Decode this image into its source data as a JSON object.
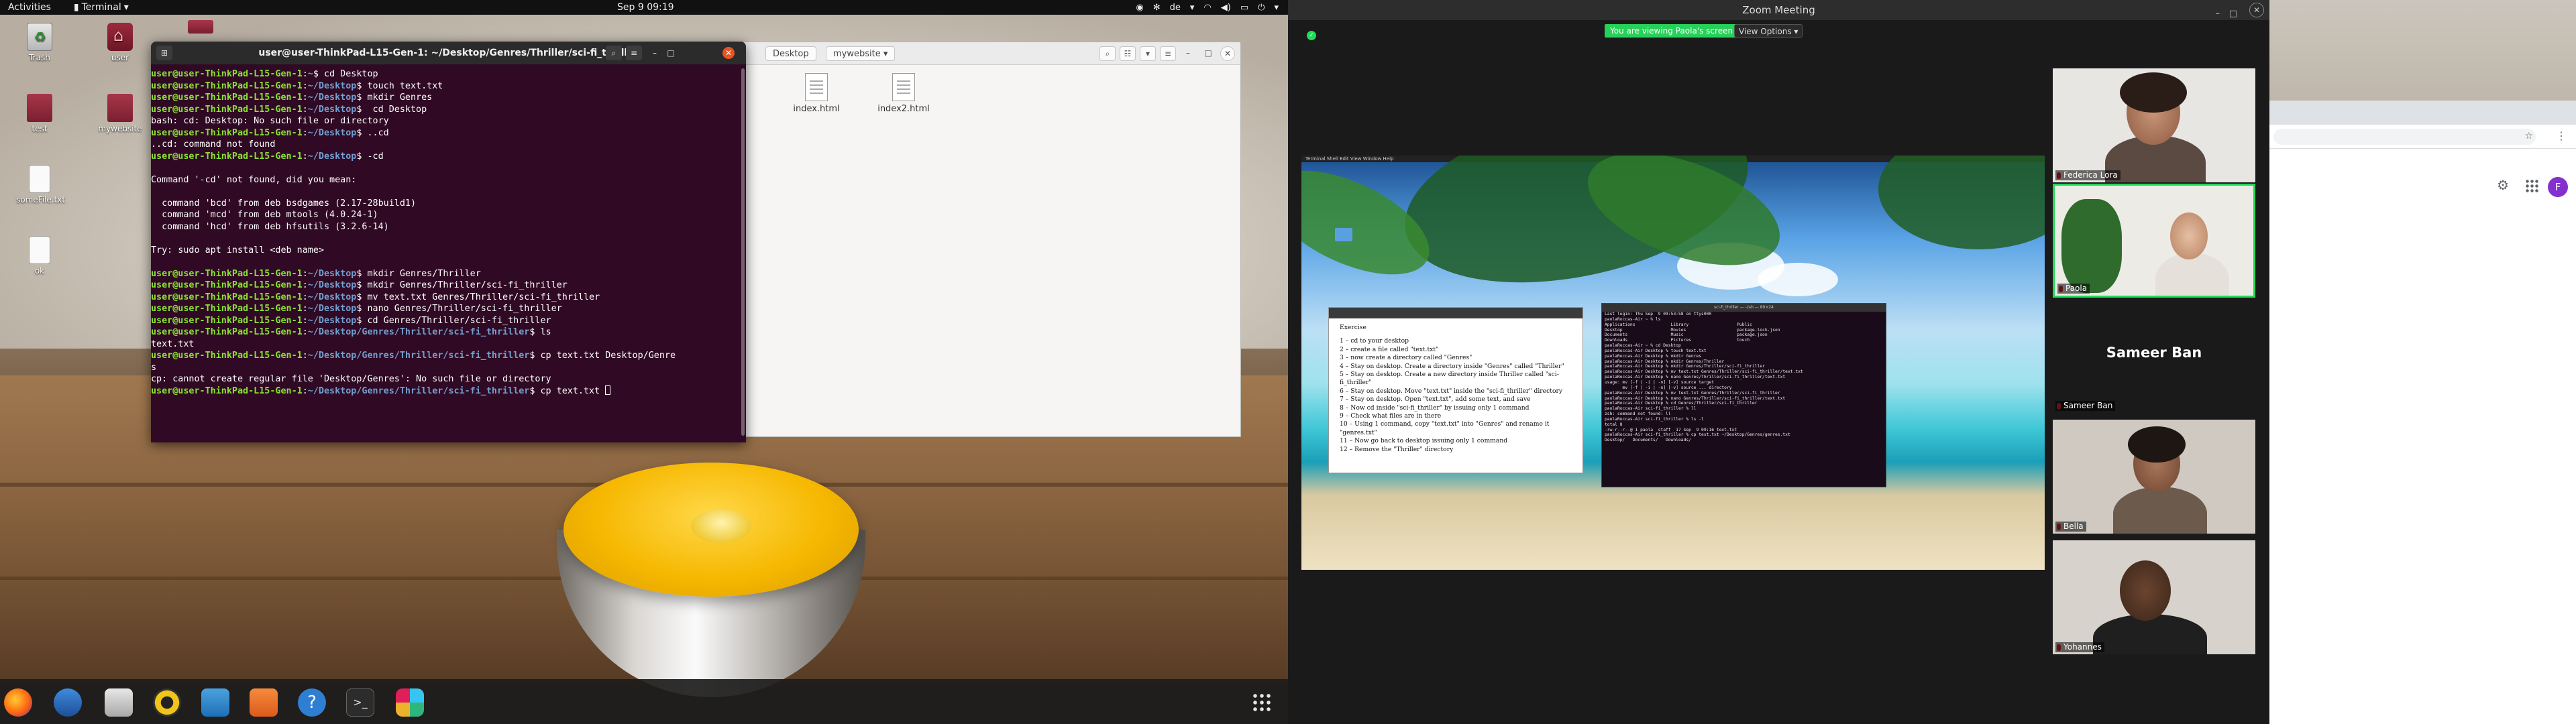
{
  "left_screen": {
    "topbar": {
      "activities": "Activities",
      "app_name": "Terminal",
      "clock": "Sep 9  09:19",
      "keyboard_layout": "de"
    },
    "desktop_icons": [
      {
        "label": "Trash",
        "icon": "trash-icon"
      },
      {
        "label": "user",
        "icon": "home-folder-icon"
      },
      {
        "label": "test",
        "icon": "folder-icon"
      },
      {
        "label": "mywebsite",
        "icon": "folder-icon"
      },
      {
        "label": "someFile.txt",
        "icon": "text-file-icon"
      },
      {
        "label": "ok",
        "icon": "text-file-icon"
      }
    ],
    "file_manager": {
      "breadcrumb": [
        "Desktop",
        "mywebsite"
      ],
      "files": [
        "index.html",
        "index2.html"
      ]
    },
    "terminal": {
      "title": "user@user-ThinkPad-L15-Gen-1: ~/Desktop/Genres/Thriller/sci-fi_thriller",
      "user_host": "user@user-ThinkPad-L15-Gen-1",
      "lines": [
        {
          "type": "prompt",
          "path": "~",
          "cmd": "$ cd Desktop"
        },
        {
          "type": "prompt",
          "path": "~/Desktop",
          "cmd": "$ touch text.txt"
        },
        {
          "type": "prompt",
          "path": "~/Desktop",
          "cmd": "$ mkdir Genres"
        },
        {
          "type": "prompt",
          "path": "~/Desktop",
          "cmd": "$  cd Desktop"
        },
        {
          "type": "out",
          "text": "bash: cd: Desktop: No such file or directory"
        },
        {
          "type": "prompt",
          "path": "~/Desktop",
          "cmd": "$ ..cd"
        },
        {
          "type": "out",
          "text": "..cd: command not found"
        },
        {
          "type": "prompt",
          "path": "~/Desktop",
          "cmd": "$ -cd"
        },
        {
          "type": "out",
          "text": ""
        },
        {
          "type": "out",
          "text": "Command '-cd' not found, did you mean:"
        },
        {
          "type": "out",
          "text": ""
        },
        {
          "type": "out",
          "text": "  command 'bcd' from deb bsdgames (2.17-28build1)"
        },
        {
          "type": "out",
          "text": "  command 'mcd' from deb mtools (4.0.24-1)"
        },
        {
          "type": "out",
          "text": "  command 'hcd' from deb hfsutils (3.2.6-14)"
        },
        {
          "type": "out",
          "text": ""
        },
        {
          "type": "out",
          "text": "Try: sudo apt install <deb name>"
        },
        {
          "type": "out",
          "text": ""
        },
        {
          "type": "prompt",
          "path": "~/Desktop",
          "cmd": "$ mkdir Genres/Thriller"
        },
        {
          "type": "prompt",
          "path": "~/Desktop",
          "cmd": "$ mkdir Genres/Thriller/sci-fi_thriller"
        },
        {
          "type": "prompt",
          "path": "~/Desktop",
          "cmd": "$ mv text.txt Genres/Thriller/sci-fi_thriller"
        },
        {
          "type": "prompt",
          "path": "~/Desktop",
          "cmd": "$ nano Genres/Thriller/sci-fi_thriller"
        },
        {
          "type": "prompt",
          "path": "~/Desktop",
          "cmd": "$ cd Genres/Thriller/sci-fi_thriller"
        },
        {
          "type": "prompt",
          "path": "~/Desktop/Genres/Thriller/sci-fi_thriller",
          "cmd": "$ ls"
        },
        {
          "type": "out",
          "text": "text.txt"
        },
        {
          "type": "prompt",
          "path": "~/Desktop/Genres/Thriller/sci-fi_thriller",
          "cmd": "$ cp text.txt Desktop/Genre"
        },
        {
          "type": "out",
          "text": "s"
        },
        {
          "type": "out",
          "text": "cp: cannot create regular file 'Desktop/Genres': No such file or directory"
        },
        {
          "type": "prompt",
          "path": "~/Desktop/Genres/Thriller/sci-fi_thriller",
          "cmd": "$ cp text.txt ",
          "cursor": true
        }
      ]
    },
    "dock_apps": [
      "firefox-icon",
      "thunderbird-icon",
      "files-icon",
      "rhythmbox-icon",
      "writer-icon",
      "software-icon",
      "help-icon",
      "terminal-icon",
      "slack-icon",
      "show-apps-icon"
    ]
  },
  "zoom": {
    "title": "Zoom Meeting",
    "viewing_banner": "You are viewing Paola's screen",
    "view_options": "View Options ▾",
    "shared_screen": {
      "exercise_title": "Exercise",
      "exercise_steps": [
        "1 – cd to your desktop",
        "2 – create a file called \"text.txt\"",
        "3 – now create a directory called \"Genres\"",
        "4 – Stay on desktop. Create a directory inside \"Genres\" called \"Thriller\"",
        "5 – Stay on desktop. Create a new directory inside Thriller called \"sci-fi_thriller\"",
        "6 – Stay on desktop. Move \"text.txt\" inside the \"sci-fi_thriller\" directory",
        "7 – Stay on desktop. Open \"text.txt\", add some text, and save",
        "8 – Now cd inside \"sci-fi_thriller\" by issuing only 1 command",
        "9 – Check what files are in there",
        "10 – Using 1 command, copy \"text.txt\" into \"Genres\" and rename it \"genres.txt\"",
        "11 – Now go back to desktop issuing only 1 command",
        "12 – Remove the \"Thriller\" directory"
      ],
      "mini_terminal_title": "sci-fi_thriller — -zsh — 80×24",
      "mini_terminal_lines": [
        "Last login: Thu Sep  9 09:53:58 on ttys000",
        "paolaRoccas-Air ~ % ls",
        "Applications              Library                   Public",
        "Desktop                   Movies                    package-lock.json",
        "Documents                 Music                     package.json",
        "Downloads                 Pictures                  touch",
        "paolaRoccas-Air ~ % cd Desktop",
        "paolaRoccas-Air Desktop % touch text.txt",
        "paolaRoccas-Air Desktop % mkdir Genres",
        "paolaRoccas-Air Desktop % mkdir Genres/Thriller",
        "paolaRoccas-Air Desktop % mkdir Genres/Thriller/sci-fi_thriller",
        "paolaRoccas-Air Desktop % mv text.txt Genres/Thriller/sci-fi_thriller/text.txt",
        "paolaRoccas-Air Desktop % nano Genres/Thriller/sci-fi_thriller/text.txt",
        "usage: mv [-f | -i | -n] [-v] source target",
        "       mv [-f | -i | -n] [-v] source ... directory",
        "paolaRoccas-Air Desktop % mv text.txt Genres/Thriller/sci-fi_thriller",
        "paolaRoccas-Air Desktop % nano Genres/Thriller/sci-fi_thriller/text.txt",
        "paolaRoccas-Air Desktop % cd Genres/Thriller/sci-fi_thriller",
        "paolaRoccas-Air sci-fi_thriller % ll",
        "zsh: command not found: ll",
        "paolaRoccas-Air sci-fi_thriller % ls -l",
        "total 8",
        "-rw-r--r--@ 1 paola  staff  17 Sep  9 09:16 text.txt",
        "paolaRoccas-Air sci-fi_thriller % cp text.txt ~/Desktop/Genres/genres.txt",
        "Desktop/   Documents/   Downloads/"
      ],
      "menubar": "Terminal   Shell   Edit   View   Window   Help"
    },
    "participants": [
      {
        "name": "Federica Lora",
        "video": true,
        "active": false
      },
      {
        "name": "Paola",
        "video": true,
        "active": true
      },
      {
        "name": "Sameer Ban",
        "video": false,
        "active": false
      },
      {
        "name": "Bella",
        "video": true,
        "active": false
      },
      {
        "name": "Yohannes",
        "video": true,
        "active": false
      }
    ]
  },
  "browser": {
    "avatar_letter": "F",
    "accent": "#8430ce"
  },
  "colors": {
    "terminal_bg": "#300a24",
    "prompt_user": "#8ae234",
    "prompt_path": "#729fcf",
    "zoom_green": "#23d959",
    "ubuntu_orange": "#e95420"
  }
}
